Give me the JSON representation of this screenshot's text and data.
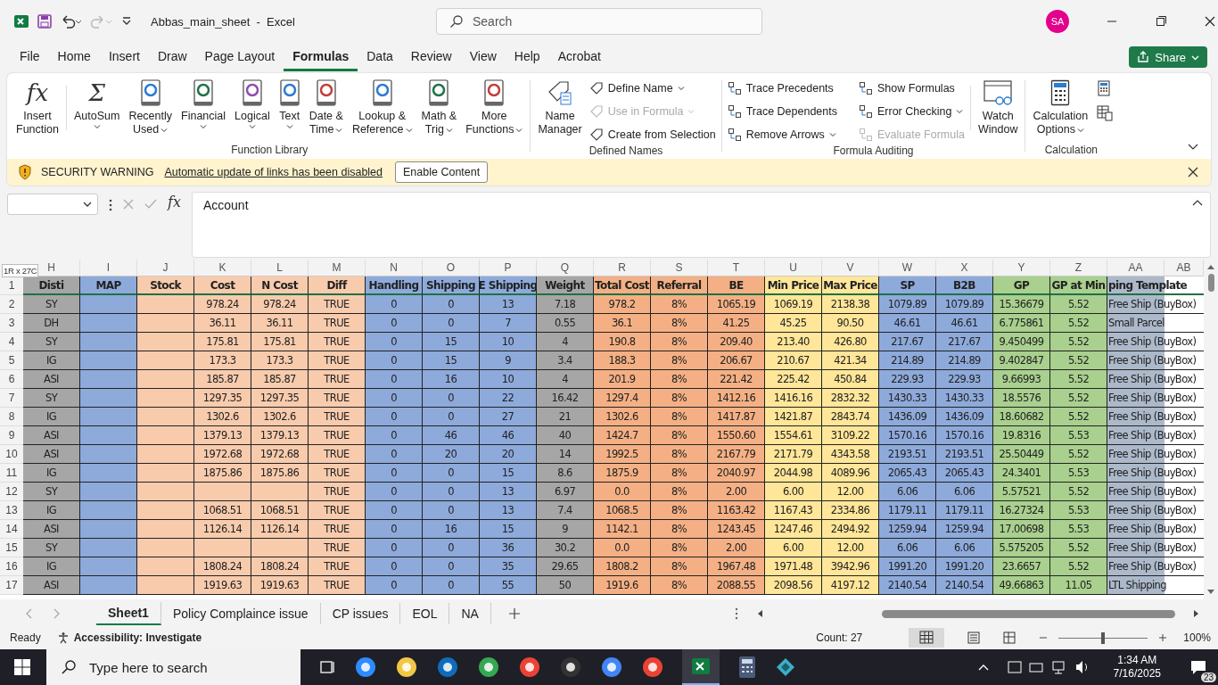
{
  "title_bar": {
    "title": "Abbas_main_sheet  -  Excel",
    "search": {
      "placeholder": "Search"
    },
    "avatar": "SA"
  },
  "menu_tabs": [
    {
      "label": "File",
      "selected": false
    },
    {
      "label": "Home",
      "selected": false
    },
    {
      "label": "Insert",
      "selected": false
    },
    {
      "label": "Draw",
      "selected": false
    },
    {
      "label": "Page Layout",
      "selected": false
    },
    {
      "label": "Formulas",
      "selected": true
    },
    {
      "label": "Data",
      "selected": false
    },
    {
      "label": "Review",
      "selected": false
    },
    {
      "label": "View",
      "selected": false
    },
    {
      "label": "Help",
      "selected": false
    },
    {
      "label": "Acrobat",
      "selected": false
    }
  ],
  "share_button": "Share",
  "function_library": {
    "label": "Function Library",
    "buttons": [
      {
        "kind": "glyph",
        "glyph": "fx",
        "lines": [
          "Insert",
          "Function"
        ],
        "dropdown": false
      },
      {
        "kind": "glyph",
        "glyph": "Σ",
        "lines": [
          "AutoSum"
        ],
        "dropdown": true
      },
      {
        "kind": "book",
        "color": "#2b7cd3",
        "lines": [
          "Recently",
          "Used"
        ],
        "dropdown": true
      },
      {
        "kind": "book",
        "color": "#217346",
        "lines": [
          "Financial"
        ],
        "dropdown": true
      },
      {
        "kind": "book",
        "color": "#8c4fb0",
        "lines": [
          "Logical"
        ],
        "dropdown": true
      },
      {
        "kind": "book",
        "color": "#2b7cd3",
        "lines": [
          "Text"
        ],
        "dropdown": true
      },
      {
        "kind": "book",
        "color": "#c43e3e",
        "lines": [
          "Date &",
          "Time"
        ],
        "dropdown": true
      },
      {
        "kind": "book",
        "color": "#2b7cd3",
        "lines": [
          "Lookup &",
          "Reference"
        ],
        "dropdown": true
      },
      {
        "kind": "book",
        "color": "#217346",
        "lines": [
          "Math &",
          "Trig"
        ],
        "dropdown": true
      },
      {
        "kind": "book",
        "color": "#c43e3e",
        "lines": [
          "More",
          "Functions"
        ],
        "dropdown": true
      }
    ]
  },
  "defined_names": {
    "label": "Defined Names",
    "manager": [
      "Name",
      "Manager"
    ],
    "items": [
      {
        "label": "Define Name",
        "dropdown": true,
        "disabled": false
      },
      {
        "label": "Use in Formula",
        "dropdown": true,
        "disabled": true
      },
      {
        "label": "Create from Selection",
        "dropdown": false,
        "disabled": false
      }
    ]
  },
  "formula_auditing": {
    "label": "Formula Auditing",
    "watch": [
      "Watch",
      "Window"
    ],
    "items": [
      {
        "label": "Trace Precedents",
        "dropdown": false,
        "disabled": false
      },
      {
        "label": "Trace Dependents",
        "dropdown": false,
        "disabled": false
      },
      {
        "label": "Remove Arrows",
        "dropdown": true,
        "disabled": false
      },
      {
        "label": "Show Formulas",
        "dropdown": false,
        "disabled": false
      },
      {
        "label": "Error Checking",
        "dropdown": true,
        "disabled": false
      },
      {
        "label": "Evaluate Formula",
        "dropdown": false,
        "disabled": true
      }
    ]
  },
  "calculation": {
    "label": "Calculation",
    "options": [
      "Calculation",
      "Options"
    ]
  },
  "security_bar": {
    "title": "SECURITY WARNING",
    "message": "Automatic update of links has been disabled",
    "button": "Enable Content"
  },
  "formula_bar": {
    "fx": "fx",
    "value": "Account"
  },
  "selection_tip": "1R x 27C",
  "sheet": {
    "columns": [
      {
        "letter": "H",
        "header": "Disti",
        "color": "#a6a6a6"
      },
      {
        "letter": "I",
        "header": "MAP",
        "color": "#8eaadb"
      },
      {
        "letter": "J",
        "header": "Stock",
        "color": "#f8cbad"
      },
      {
        "letter": "K",
        "header": "Cost",
        "color": "#f8cbad"
      },
      {
        "letter": "L",
        "header": "N Cost",
        "color": "#f8cbad"
      },
      {
        "letter": "M",
        "header": "Diff",
        "color": "#f8cbad"
      },
      {
        "letter": "N",
        "header": "Handling",
        "color": "#8eaadb"
      },
      {
        "letter": "O",
        "header": "Shipping",
        "color": "#8eaadb"
      },
      {
        "letter": "P",
        "header": "E Shipping",
        "color": "#8eaadb"
      },
      {
        "letter": "Q",
        "header": "Weight",
        "color": "#a6a6a6"
      },
      {
        "letter": "R",
        "header": "Total Cost",
        "color": "#f4b084"
      },
      {
        "letter": "S",
        "header": "Referral",
        "color": "#f4b084"
      },
      {
        "letter": "T",
        "header": "BE",
        "color": "#f4b084"
      },
      {
        "letter": "U",
        "header": "Min Price",
        "color": "#ffe699"
      },
      {
        "letter": "V",
        "header": "Max Price",
        "color": "#ffe699"
      },
      {
        "letter": "W",
        "header": "SP",
        "color": "#8eaadb"
      },
      {
        "letter": "X",
        "header": "B2B",
        "color": "#8eaadb"
      },
      {
        "letter": "Y",
        "header": "GP",
        "color": "#a9d08e"
      },
      {
        "letter": "Z",
        "header": "GP at Min",
        "color": "#a9d08e"
      },
      {
        "letter": "AA",
        "header": "ping Template",
        "color": "#acb9ca"
      },
      {
        "letter": "AB"
      }
    ],
    "header_row": "1",
    "rows": [
      {
        "number": "2",
        "cells": [
          "SY",
          null,
          null,
          "978.24",
          "978.24",
          "TRUE",
          "0",
          "0",
          "13",
          "7.18",
          "978.2",
          "8%",
          "1065.19",
          "1069.19",
          "2138.38",
          "1079.89",
          "1079.89",
          "15.36679",
          "5.52",
          "Free Ship (BuyBox)"
        ]
      },
      {
        "number": "3",
        "cells": [
          "DH",
          null,
          null,
          "36.11",
          "36.11",
          "TRUE",
          "0",
          "0",
          "7",
          "0.55",
          "36.1",
          "8%",
          "41.25",
          "45.25",
          "90.50",
          "46.61",
          "46.61",
          "6.775861",
          "5.52",
          "Small Parcel"
        ]
      },
      {
        "number": "4",
        "cells": [
          "SY",
          null,
          null,
          "175.81",
          "175.81",
          "TRUE",
          "0",
          "15",
          "10",
          "4",
          "190.8",
          "8%",
          "209.40",
          "213.40",
          "426.80",
          "217.67",
          "217.67",
          "9.450499",
          "5.52",
          "Free Ship (BuyBox)"
        ]
      },
      {
        "number": "5",
        "cells": [
          "IG",
          null,
          null,
          "173.3",
          "173.3",
          "TRUE",
          "0",
          "15",
          "9",
          "3.4",
          "188.3",
          "8%",
          "206.67",
          "210.67",
          "421.34",
          "214.89",
          "214.89",
          "9.402847",
          "5.52",
          "Free Ship (BuyBox)"
        ]
      },
      {
        "number": "6",
        "cells": [
          "ASI",
          null,
          null,
          "185.87",
          "185.87",
          "TRUE",
          "0",
          "16",
          "10",
          "4",
          "201.9",
          "8%",
          "221.42",
          "225.42",
          "450.84",
          "229.93",
          "229.93",
          "9.66993",
          "5.52",
          "Free Ship (BuyBox)"
        ]
      },
      {
        "number": "7",
        "cells": [
          "SY",
          null,
          null,
          "1297.35",
          "1297.35",
          "TRUE",
          "0",
          "0",
          "22",
          "16.42",
          "1297.4",
          "8%",
          "1412.16",
          "1416.16",
          "2832.32",
          "1430.33",
          "1430.33",
          "18.5576",
          "5.52",
          "Free Ship (BuyBox)"
        ]
      },
      {
        "number": "8",
        "cells": [
          "IG",
          null,
          null,
          "1302.6",
          "1302.6",
          "TRUE",
          "0",
          "0",
          "27",
          "21",
          "1302.6",
          "8%",
          "1417.87",
          "1421.87",
          "2843.74",
          "1436.09",
          "1436.09",
          "18.60682",
          "5.52",
          "Free Ship (BuyBox)"
        ]
      },
      {
        "number": "9",
        "cells": [
          "ASI",
          null,
          null,
          "1379.13",
          "1379.13",
          "TRUE",
          "0",
          "46",
          "46",
          "40",
          "1424.7",
          "8%",
          "1550.60",
          "1554.61",
          "3109.22",
          "1570.16",
          "1570.16",
          "19.8316",
          "5.53",
          "Free Ship (BuyBox)"
        ]
      },
      {
        "number": "10",
        "cells": [
          "ASI",
          null,
          null,
          "1972.68",
          "1972.68",
          "TRUE",
          "0",
          "20",
          "20",
          "14",
          "1992.5",
          "8%",
          "2167.79",
          "2171.79",
          "4343.58",
          "2193.51",
          "2193.51",
          "25.50449",
          "5.52",
          "Free Ship (BuyBox)"
        ]
      },
      {
        "number": "11",
        "cells": [
          "IG",
          null,
          null,
          "1875.86",
          "1875.86",
          "TRUE",
          "0",
          "0",
          "15",
          "8.6",
          "1875.9",
          "8%",
          "2040.97",
          "2044.98",
          "4089.96",
          "2065.43",
          "2065.43",
          "24.3401",
          "5.53",
          "Free Ship (BuyBox)"
        ]
      },
      {
        "number": "12",
        "cells": [
          "SY",
          null,
          null,
          null,
          null,
          "TRUE",
          "0",
          "0",
          "13",
          "6.97",
          "0.0",
          "8%",
          "2.00",
          "6.00",
          "12.00",
          "6.06",
          "6.06",
          "5.57521",
          "5.52",
          "Free Ship (BuyBox)"
        ]
      },
      {
        "number": "13",
        "cells": [
          "IG",
          null,
          null,
          "1068.51",
          "1068.51",
          "TRUE",
          "0",
          "0",
          "13",
          "7.4",
          "1068.5",
          "8%",
          "1163.42",
          "1167.43",
          "2334.86",
          "1179.11",
          "1179.11",
          "16.27324",
          "5.53",
          "Free Ship (BuyBox)"
        ]
      },
      {
        "number": "14",
        "cells": [
          "ASI",
          null,
          null,
          "1126.14",
          "1126.14",
          "TRUE",
          "0",
          "16",
          "15",
          "9",
          "1142.1",
          "8%",
          "1243.45",
          "1247.46",
          "2494.92",
          "1259.94",
          "1259.94",
          "17.00698",
          "5.53",
          "Free Ship (BuyBox)"
        ]
      },
      {
        "number": "15",
        "cells": [
          "SY",
          null,
          null,
          null,
          null,
          "TRUE",
          "0",
          "0",
          "36",
          "30.2",
          "0.0",
          "8%",
          "2.00",
          "6.00",
          "12.00",
          "6.06",
          "6.06",
          "5.575205",
          "5.52",
          "Free Ship (BuyBox)"
        ]
      },
      {
        "number": "16",
        "cells": [
          "IG",
          null,
          null,
          "1808.24",
          "1808.24",
          "TRUE",
          "0",
          "0",
          "35",
          "29.65",
          "1808.2",
          "8%",
          "1967.48",
          "1971.48",
          "3942.96",
          "1991.20",
          "1991.20",
          "23.6657",
          "5.52",
          "Free Ship (BuyBox)"
        ]
      },
      {
        "number": "17",
        "cells": [
          "ASI",
          null,
          null,
          "1919.63",
          "1919.63",
          "TRUE",
          "0",
          "0",
          "55",
          "50",
          "1919.6",
          "8%",
          "2088.55",
          "2098.56",
          "4197.12",
          "2140.54",
          "2140.54",
          "49.66863",
          "11.05",
          "LTL Shipping"
        ]
      }
    ]
  },
  "sheet_tabs": [
    {
      "label": "Sheet1",
      "selected": true
    },
    {
      "label": "Policy Complaince issue",
      "selected": false
    },
    {
      "label": "CP issues",
      "selected": false
    },
    {
      "label": "EOL",
      "selected": false
    },
    {
      "label": "NA",
      "selected": false
    }
  ],
  "status_bar": {
    "mode": "Ready",
    "accessibility": "Accessibility: Investigate",
    "count": "Count: 27",
    "zoom": "100%",
    "zoom_slider": {
      "level": 0.5
    }
  },
  "taskbar": {
    "search_placeholder": "Type here to search",
    "time": "1:34 AM",
    "date": "7/16/2025",
    "notifications": "23"
  }
}
